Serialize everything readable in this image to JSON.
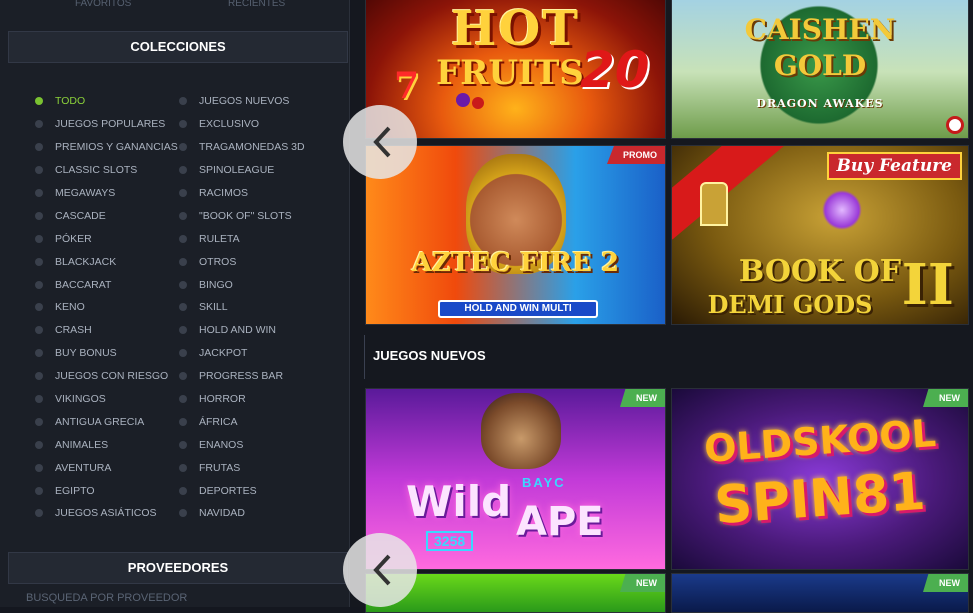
{
  "top_links": {
    "favoritos": "FAVORITOS",
    "recientes": "RECIENTES"
  },
  "colecciones": {
    "header": "COLECCIONES",
    "left": [
      "TODO",
      "JUEGOS POPULARES",
      "PREMIOS Y GANANCIAS",
      "CLASSIC SLOTS",
      "MEGAWAYS",
      "CASCADE",
      "PÓKER",
      "BLACKJACK",
      "BACCARAT",
      "KENO",
      "CRASH",
      "BUY BONUS",
      "JUEGOS CON RIESGO",
      "VIKINGOS",
      "ANTIGUA GRECIA",
      "ANIMALES",
      "AVENTURA",
      "EGIPTO",
      "JUEGOS ASIÁTICOS"
    ],
    "right": [
      "JUEGOS NUEVOS",
      "EXCLUSIVO",
      "TRAGAMONEDAS 3D",
      "SPINOLEAGUE",
      "RACIMOS",
      "\"BOOK OF\" SLOTS",
      "RULETA",
      "OTROS",
      "BINGO",
      "SKILL",
      "HOLD AND WIN",
      "JACKPOT",
      "PROGRESS BAR",
      "HORROR",
      "ÁFRICA",
      "ENANOS",
      "FRUTAS",
      "DEPORTES",
      "NAVIDAD"
    ],
    "active": "TODO"
  },
  "proveedores": {
    "header": "PROVEEDORES",
    "search_placeholder": "BUSQUEDA POR PROVEEDOR"
  },
  "games": {
    "hot_fruits": {
      "line1": "HOT",
      "line2": "FRUITS",
      "num": "20"
    },
    "caishen": {
      "line1": "CAISHEN",
      "line2": "GOLD",
      "line3": "DRAGON AWAKES"
    },
    "aztec": {
      "line1": "AZTEC FIRE 2",
      "line2": "HOLD AND WIN MULTI",
      "badge": "PROMO"
    },
    "book_of": {
      "line1": "BOOK OF",
      "line2": "DEMI GODS",
      "num": "II",
      "badge": "Buy Feature"
    },
    "wild_ape": {
      "line1": "Wild",
      "line2": "APE",
      "tag": "BAYC",
      "code": "3258",
      "badge": "NEW"
    },
    "oldskool": {
      "line1": "OLDSKOOL",
      "line2": "SPIN81",
      "badge": "NEW"
    },
    "bottom_left": {
      "badge": "NEW"
    },
    "bottom_right": {
      "badge": "NEW"
    }
  },
  "section_juegos_nuevos": "JUEGOS NUEVOS"
}
